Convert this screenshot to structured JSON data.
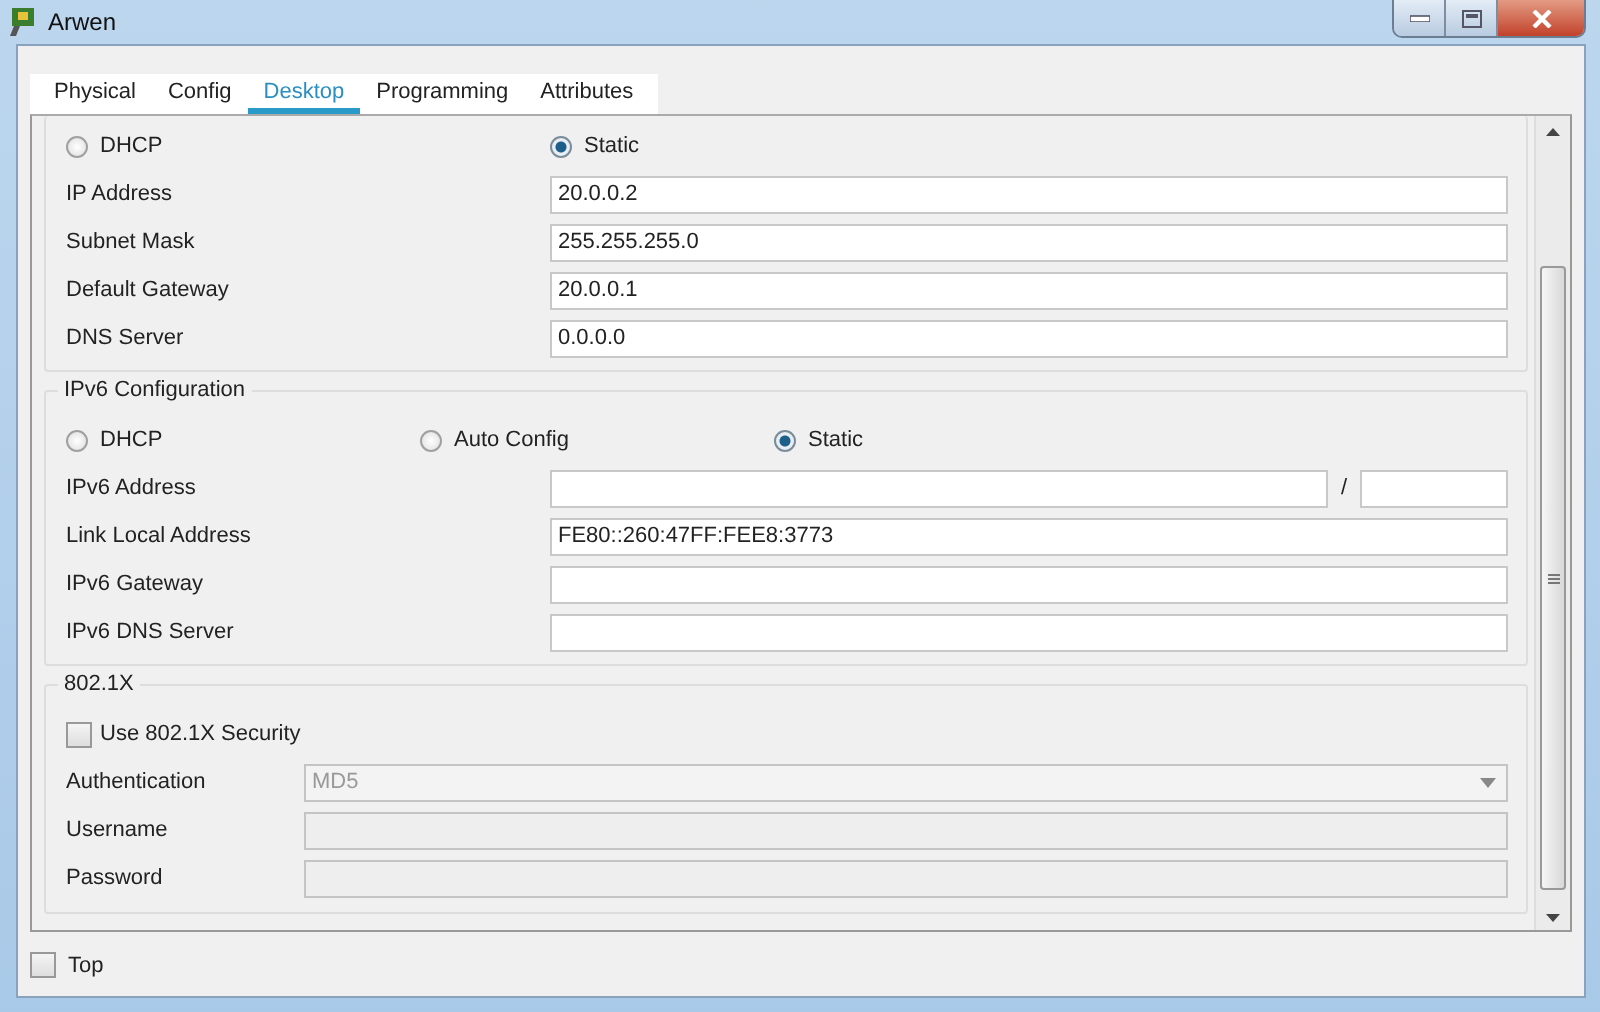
{
  "window": {
    "title": "Arwen"
  },
  "tabs": [
    {
      "label": "Physical",
      "selected": false
    },
    {
      "label": "Config",
      "selected": false
    },
    {
      "label": "Desktop",
      "selected": true
    },
    {
      "label": "Programming",
      "selected": false
    },
    {
      "label": "Attributes",
      "selected": false
    }
  ],
  "ipv4": {
    "modes": [
      {
        "label": "DHCP",
        "selected": false
      },
      {
        "label": "Static",
        "selected": true
      }
    ],
    "fields": [
      {
        "label": "IP Address",
        "value": "20.0.0.2"
      },
      {
        "label": "Subnet Mask",
        "value": "255.255.255.0"
      },
      {
        "label": "Default Gateway",
        "value": "20.0.0.1"
      },
      {
        "label": "DNS Server",
        "value": "0.0.0.0"
      }
    ]
  },
  "ipv6": {
    "title": "IPv6 Configuration",
    "modes": [
      {
        "label": "DHCP",
        "selected": false
      },
      {
        "label": "Auto Config",
        "selected": false
      },
      {
        "label": "Static",
        "selected": true
      }
    ],
    "fields": [
      {
        "label": "IPv6 Address",
        "kind": "prefix",
        "separator": "/"
      },
      {
        "label": "Link Local Address",
        "kind": "text",
        "value": "FE80::260:47FF:FEE8:3773"
      },
      {
        "label": "IPv6 Gateway",
        "kind": "text"
      },
      {
        "label": "IPv6 DNS Server",
        "kind": "text"
      }
    ]
  },
  "dot1x": {
    "title": "802.1X",
    "security": {
      "label": "Use 802.1X Security",
      "checked": false
    },
    "fields": [
      {
        "label": "Authentication",
        "kind": "dropdown",
        "value": "MD5",
        "disabled": true
      },
      {
        "label": "Username",
        "kind": "text",
        "disabled": true
      },
      {
        "label": "Password",
        "kind": "text",
        "disabled": true
      }
    ]
  },
  "top": {
    "label": "Top",
    "checked": false
  }
}
